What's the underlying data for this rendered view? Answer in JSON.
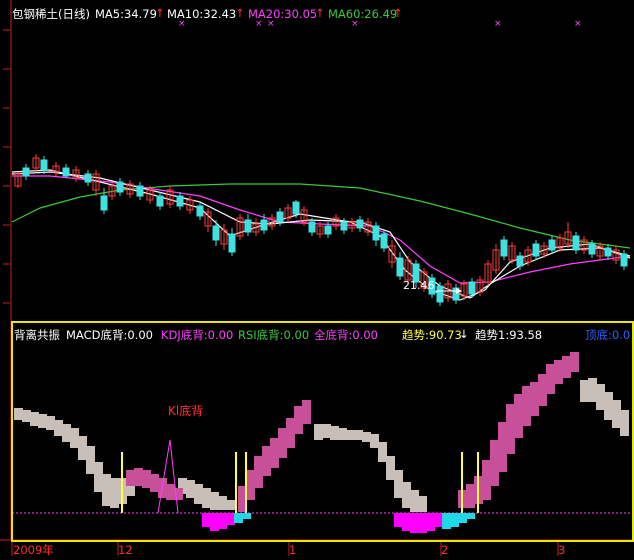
{
  "main_panel": {
    "stock_name": "包钢稀土(日线)",
    "ma5": {
      "label": "MA5:34.79",
      "color": "#ffffff"
    },
    "ma10": {
      "label": "MA10:32.43",
      "color": "#ffffff"
    },
    "ma20": {
      "label": "MA20:30.05",
      "color": "#ff40ff"
    },
    "ma60": {
      "label": "MA60:26.49",
      "color": "#3cc83c"
    },
    "arrow_up": "↑",
    "low_marker": "21.46",
    "candle_up_color": "#ff3c3c",
    "candle_down_color": "#40e0e0",
    "x_markers": [
      "×",
      "×",
      "×",
      "×",
      "×",
      "×"
    ]
  },
  "indicator_panel": {
    "title": "背离共振",
    "macd": "MACD底背:0.00",
    "kdj": "KDJ底背:0.00",
    "rsi": "RSI底背:0.00",
    "all": "全底背:0.00",
    "trend": "趋势:90.73",
    "trend_arrow": "↓",
    "trend1": "趋势1:93.58",
    "extra": "顶底:0.0",
    "annotation": "Kl底背",
    "colors": {
      "gray": "#c8c0b8",
      "pink": "#c8509a",
      "magenta": "#ff00ff",
      "cyan": "#20d8e8",
      "yellow": "#ffff40"
    }
  },
  "time_axis": [
    "2009年",
    "12",
    "1",
    "2",
    "3"
  ]
}
